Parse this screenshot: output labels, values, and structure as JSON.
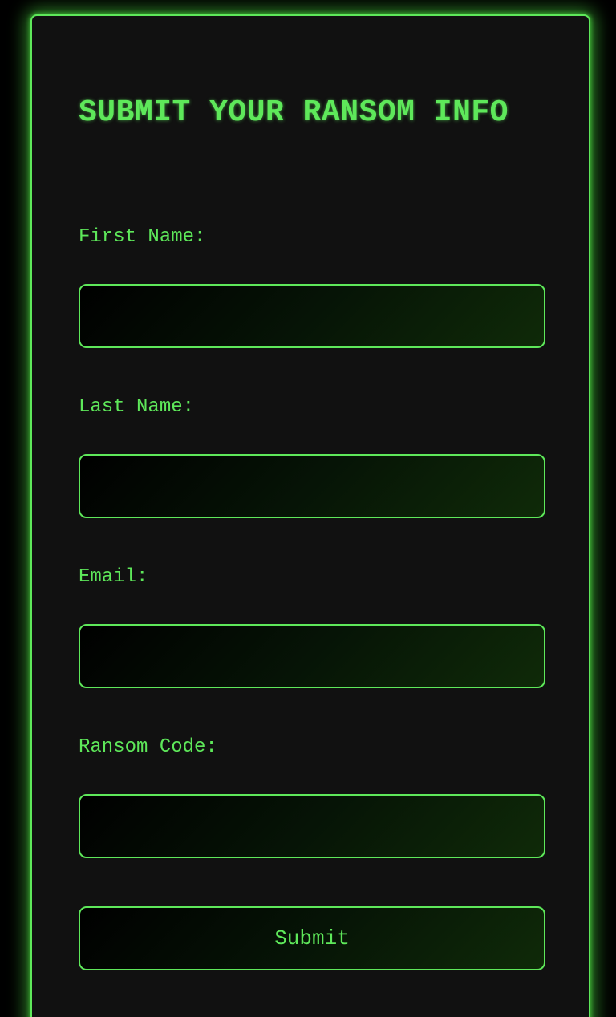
{
  "form": {
    "title": "SUBMIT YOUR RANSOM INFO",
    "fields": [
      {
        "label": "First Name:",
        "value": "",
        "placeholder": ""
      },
      {
        "label": "Last Name:",
        "value": "",
        "placeholder": ""
      },
      {
        "label": "Email:",
        "value": "",
        "placeholder": ""
      },
      {
        "label": "Ransom Code:",
        "value": "",
        "placeholder": ""
      }
    ],
    "submit_label": "Submit"
  },
  "colors": {
    "accent": "#5ee85a",
    "panel_bg": "#111111",
    "page_bg": "#000000"
  }
}
